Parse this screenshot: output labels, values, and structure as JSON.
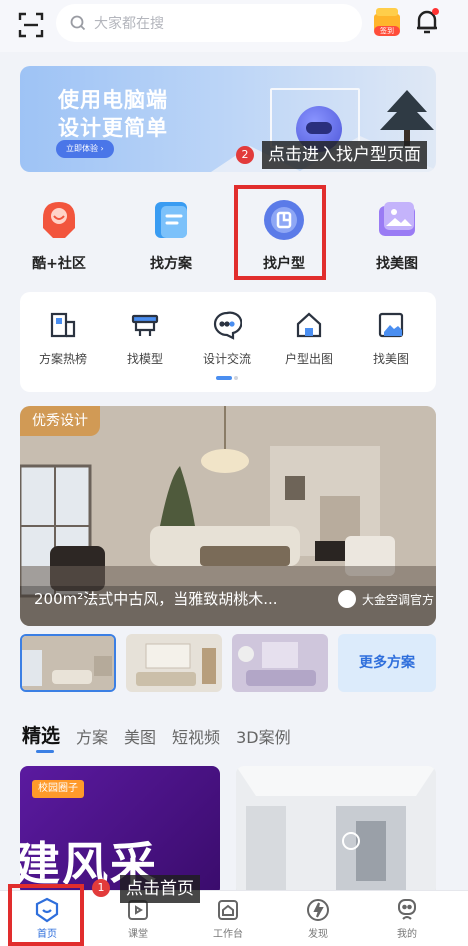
{
  "header": {
    "search_placeholder": "大家都在搜",
    "gift_tag": "签到"
  },
  "banner": {
    "line1": "使用电脑端",
    "line2": "设计更简单",
    "button": "立即体验 ›"
  },
  "main_icons": [
    {
      "label": "酷+社区",
      "icon": "community-icon"
    },
    {
      "label": "找方案",
      "icon": "plan-icon"
    },
    {
      "label": "找户型",
      "icon": "floorplan-icon"
    },
    {
      "label": "找美图",
      "icon": "gallery-icon"
    }
  ],
  "tools": [
    {
      "label": "方案热榜",
      "icon": "ranking-icon"
    },
    {
      "label": "找模型",
      "icon": "model-icon"
    },
    {
      "label": "设计交流",
      "icon": "chat-icon"
    },
    {
      "label": "户型出图",
      "icon": "house-render-icon"
    },
    {
      "label": "找美图",
      "icon": "image-icon"
    }
  ],
  "hero": {
    "tag": "优秀设计",
    "title": "200m²法式中古风，当雅致胡桃木...",
    "author": "大金空调官方"
  },
  "more_plans": "更多方案",
  "tabs": [
    "精选",
    "方案",
    "美图",
    "短视频",
    "3D案例"
  ],
  "feed": {
    "left_tag": "校园圈子",
    "left_big_text": "建风采"
  },
  "bottom_nav": [
    {
      "label": "首页",
      "icon": "home-icon",
      "active": true
    },
    {
      "label": "课堂",
      "icon": "classroom-icon",
      "active": false
    },
    {
      "label": "工作台",
      "icon": "workbench-icon",
      "active": false
    },
    {
      "label": "发现",
      "icon": "discover-icon",
      "active": false
    },
    {
      "label": "我的",
      "icon": "profile-icon",
      "active": false
    }
  ],
  "annotations": {
    "step1_num": "1",
    "step1_text": "点击首页",
    "step2_num": "2",
    "step2_text": "点击进入找户型页面"
  },
  "colors": {
    "accent": "#3b7fe4",
    "highlight_box": "#e12d2d",
    "hero_tag": "#d19a55"
  }
}
